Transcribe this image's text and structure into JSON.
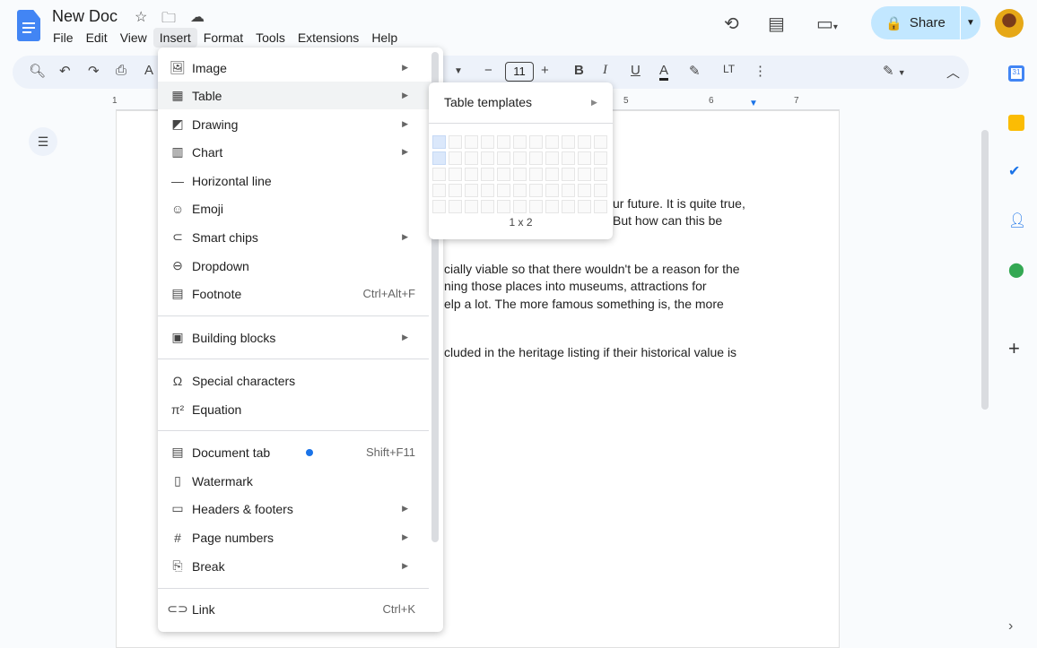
{
  "app": {
    "title": "New Doc",
    "menus": [
      "File",
      "Edit",
      "View",
      "Insert",
      "Format",
      "Tools",
      "Extensions",
      "Help"
    ],
    "active_menu": "Insert",
    "share_label": "Share"
  },
  "toolbar": {
    "font_size": "11"
  },
  "ruler": {
    "labels": [
      "1",
      "5",
      "6",
      "7"
    ]
  },
  "document": {
    "lines": [
      "ur future. It is quite true,",
      "But how can this be",
      "cially viable so that there wouldn't be a reason for the",
      "ning those places into museums, attractions for",
      "elp a lot. The more famous something is, the more",
      "cluded in the heritage listing if their historical value is"
    ]
  },
  "insert_menu": {
    "items": [
      {
        "label": "Image",
        "icon": "image-icon",
        "submenu": true
      },
      {
        "label": "Table",
        "icon": "table-icon",
        "submenu": true,
        "highlighted": true
      },
      {
        "label": "Drawing",
        "icon": "drawing-icon",
        "submenu": true
      },
      {
        "label": "Chart",
        "icon": "chart-icon",
        "submenu": true
      },
      {
        "label": "Horizontal line",
        "icon": "horizontal-line-icon"
      },
      {
        "label": "Emoji",
        "icon": "emoji-icon"
      },
      {
        "label": "Smart chips",
        "icon": "smart-chips-icon",
        "submenu": true
      },
      {
        "label": "Dropdown",
        "icon": "dropdown-icon"
      },
      {
        "label": "Footnote",
        "icon": "footnote-icon",
        "shortcut": "Ctrl+Alt+F"
      },
      {
        "label": "Building blocks",
        "icon": "building-blocks-icon",
        "submenu": true
      },
      {
        "label": "Special characters",
        "icon": "omega-icon"
      },
      {
        "label": "Equation",
        "icon": "pi-icon"
      },
      {
        "label": "Document tab",
        "icon": "document-tab-icon",
        "shortcut": "Shift+F11",
        "badge": true
      },
      {
        "label": "Watermark",
        "icon": "watermark-icon"
      },
      {
        "label": "Headers & footers",
        "icon": "headers-footers-icon",
        "submenu": true
      },
      {
        "label": "Page numbers",
        "icon": "hash-icon",
        "submenu": true
      },
      {
        "label": "Break",
        "icon": "break-icon",
        "submenu": true
      },
      {
        "label": "Link",
        "icon": "link-icon",
        "shortcut": "Ctrl+K"
      }
    ]
  },
  "table_submenu": {
    "templates_label": "Table templates",
    "grid_size_label": "1 x 2",
    "grid_columns": 11,
    "grid_rows": 5,
    "selected_columns": 1,
    "selected_rows": 2
  },
  "colors": {
    "accent": "#1a73e8",
    "share_bg": "#c2e7ff",
    "toolbar_bg": "#edf2fa"
  }
}
